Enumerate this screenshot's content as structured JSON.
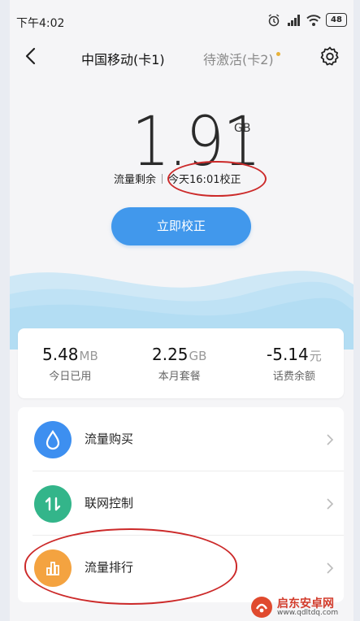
{
  "status_bar": {
    "time": "下午4:02",
    "battery": "48"
  },
  "nav": {
    "tab_sim1": "中国移动(卡1)",
    "tab_sim2": "待激活(卡2)"
  },
  "data_usage": {
    "remaining_value": "1.91",
    "remaining_unit": "GB",
    "remaining_label": "流量剩余",
    "calibrated_text": "今天16:01校正",
    "calibrate_button": "立即校正"
  },
  "stats": [
    {
      "value": "5.48",
      "unit": "MB",
      "label": "今日已用"
    },
    {
      "value": "2.25",
      "unit": "GB",
      "label": "本月套餐"
    },
    {
      "value": "-5.14",
      "unit": "元",
      "label": "话费余额"
    }
  ],
  "menu": [
    {
      "label": "流量购买",
      "icon": "water-drop-icon",
      "color": "#3d8ff0"
    },
    {
      "label": "联网控制",
      "icon": "updown-arrows-icon",
      "color": "#33b58a"
    },
    {
      "label": "流量排行",
      "icon": "bar-chart-icon",
      "color": "#f4a340"
    }
  ],
  "watermark": {
    "name": "启东安卓网",
    "url": "www.qdltdq.com"
  },
  "colors": {
    "accent": "#4198ec",
    "annotation": "#cc2a2a"
  }
}
